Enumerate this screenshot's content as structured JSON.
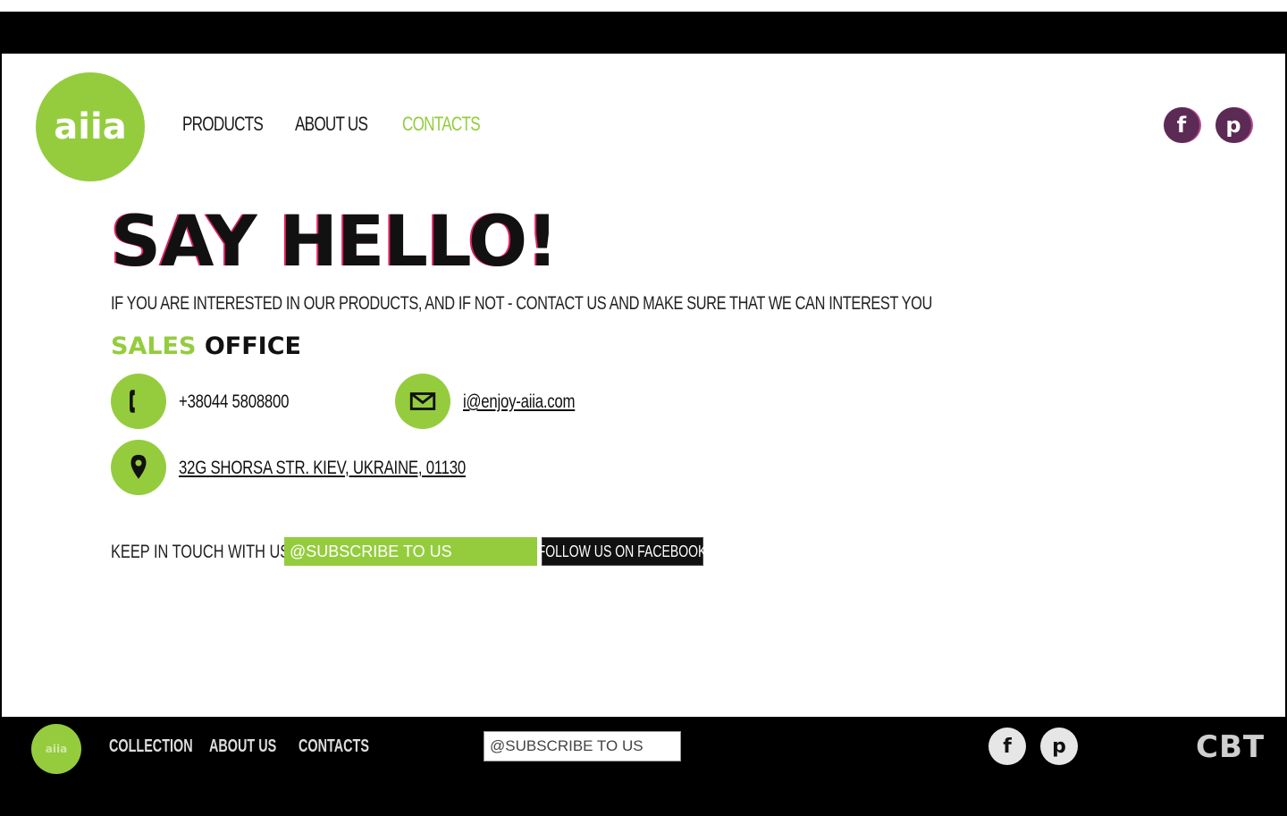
{
  "logo": {
    "text": "aiia"
  },
  "nav": {
    "items": [
      {
        "label": "PRODUCTS"
      },
      {
        "label": "ABOUT US"
      },
      {
        "label": "CONTACTS"
      }
    ],
    "active": "CONTACTS"
  },
  "social": {
    "facebook": "f",
    "pinterest": "p"
  },
  "hero": {
    "title": "SAY HELLO!"
  },
  "intro": {
    "text": "IF YOU ARE INTERESTED IN OUR PRODUCTS, AND IF NOT - CONTACT US AND MAKE SURE THAT WE CAN INTEREST YOU"
  },
  "sales": {
    "word1": "SALES",
    "word2": "OFFICE"
  },
  "contact": {
    "phone": "+38044 5808800",
    "email": "i@enjoy-aiia.com",
    "address": "32G SHORSA STR. KIEV, UKRAINE, 01130"
  },
  "keep": {
    "label": "KEEP IN TOUCH WITH US",
    "subscribe_placeholder": "@SUBSCRIBE TO US",
    "facebook_button": "FOLLOW US ON FACEBOOK"
  },
  "footer": {
    "logo_text": "aiia",
    "nav": [
      "COLLECTION",
      "ABOUT US",
      "CONTACTS"
    ],
    "subscribe_placeholder": "@SUBSCRIBE TO US",
    "brand": "CBT"
  },
  "colors": {
    "accent": "#94cc3e",
    "dark": "#111111",
    "social": "#5b2a55"
  }
}
